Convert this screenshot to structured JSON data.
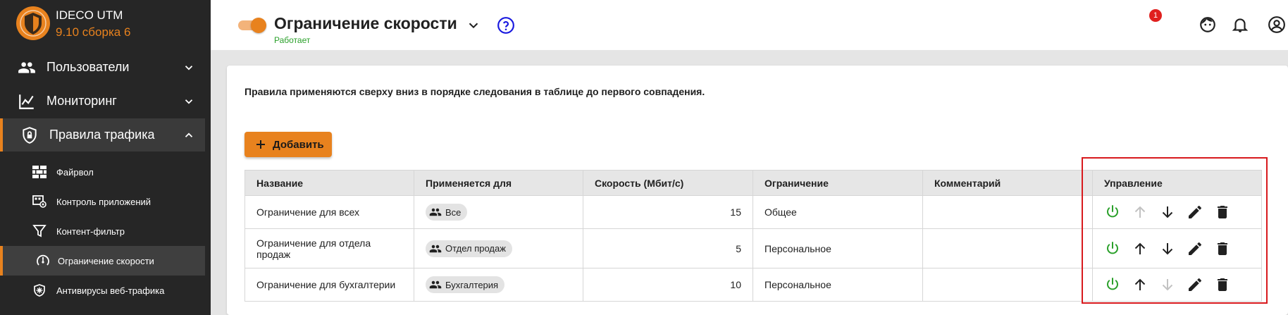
{
  "app": {
    "name": "IDECO UTM",
    "version": "9.10 сборка 6"
  },
  "sidebar": {
    "items": [
      {
        "label": "Пользователи",
        "icon": "users-icon"
      },
      {
        "label": "Мониторинг",
        "icon": "chart-line-icon"
      },
      {
        "label": "Правила трафика",
        "icon": "shield-lock-icon",
        "active": true
      }
    ],
    "subitems": [
      {
        "label": "Файрвол",
        "icon": "firewall-icon"
      },
      {
        "label": "Контроль приложений",
        "icon": "app-control-icon"
      },
      {
        "label": "Контент-фильтр",
        "icon": "filter-icon"
      },
      {
        "label": "Ограничение скорости",
        "icon": "speedometer-icon",
        "active": true
      },
      {
        "label": "Антивирусы веб-трафика",
        "icon": "virus-shield-icon"
      }
    ]
  },
  "header": {
    "title": "Ограничение скорости",
    "status": "Работает",
    "notifications_count": "1"
  },
  "main": {
    "info": "Правила применяются сверху вниз в порядке следования в таблице до первого совпадения.",
    "add_label": "Добавить",
    "table": {
      "columns": [
        "Название",
        "Применяется для",
        "Скорость (Мбит/с)",
        "Ограничение",
        "Комментарий",
        "Управление"
      ],
      "rows": [
        {
          "name": "Ограничение для всех",
          "applies_to": "Все",
          "speed": "15",
          "limit": "Общее",
          "comment": ""
        },
        {
          "name": "Ограничение для отдела продаж",
          "applies_to": "Отдел продаж",
          "speed": "5",
          "limit": "Персональное",
          "comment": ""
        },
        {
          "name": "Ограничение для бухгалтерии",
          "applies_to": "Бухгалтерия",
          "speed": "10",
          "limit": "Персональное",
          "comment": ""
        }
      ]
    }
  },
  "colors": {
    "accent": "#e8821e",
    "sidebar_bg": "#262626",
    "status_green": "#2aa02a",
    "highlight_red": "#d8191d",
    "help_blue": "#1a1adf"
  }
}
